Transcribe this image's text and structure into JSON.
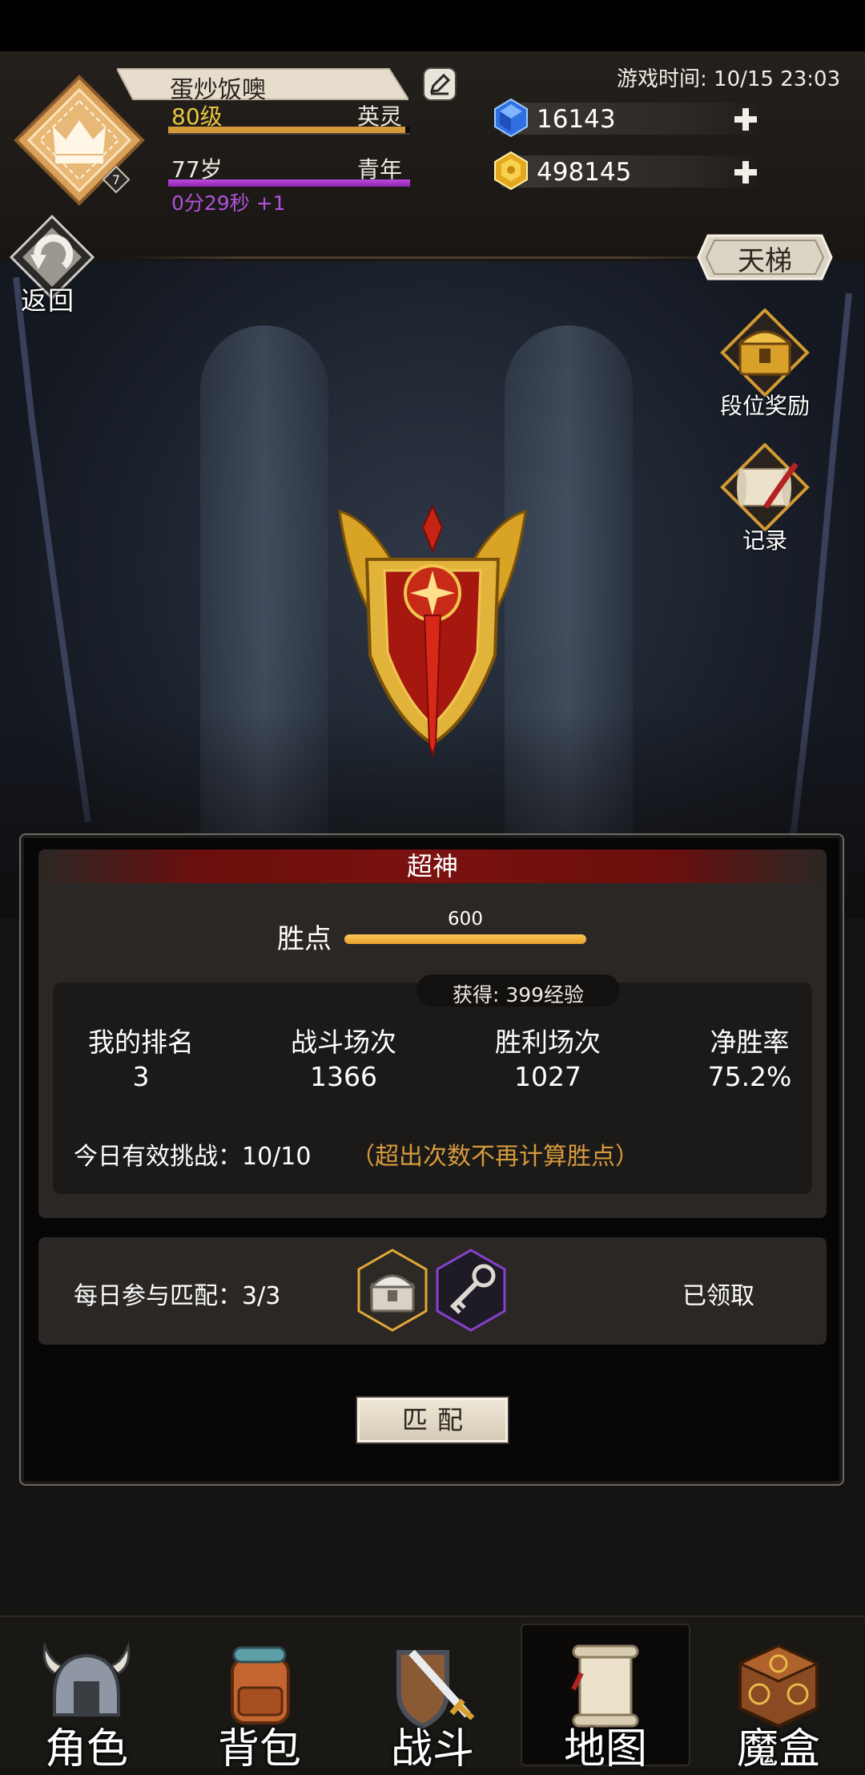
{
  "header": {
    "player_name": "蛋炒饭噢",
    "level": "80级",
    "class_name": "英灵",
    "level_progress": 0.98,
    "age": "77岁",
    "life_stage": "青年",
    "age_progress": 1.0,
    "age_timer": "0分29秒 +1",
    "avatar_level": "7",
    "game_time": "游戏时间: 10/15 23:03",
    "gems": "16143",
    "gold": "498145",
    "back_label": "返回"
  },
  "side_menu": {
    "ladder_label": "天梯",
    "rank_reward_label": "段位奖励",
    "record_label": "记录"
  },
  "rank_panel": {
    "rank_title": "超神",
    "points_label": "胜点",
    "points_value": "600",
    "points_progress": 1.0,
    "exp_gain": "获得: 399经验",
    "stats": [
      {
        "label": "我的排名",
        "value": "3"
      },
      {
        "label": "战斗场次",
        "value": "1366"
      },
      {
        "label": "胜利场次",
        "value": "1027"
      },
      {
        "label": "净胜率",
        "value": "75.2%"
      }
    ],
    "daily_challenge": "今日有效挑战：10/10",
    "daily_challenge_note": "（超出次数不再计算胜点）"
  },
  "match_panel": {
    "daily_match": "每日参与匹配：3/3",
    "claimed_label": "已领取",
    "match_button": "匹配"
  },
  "nav": {
    "items": [
      {
        "label": "角色",
        "icon": "helmet-icon"
      },
      {
        "label": "背包",
        "icon": "backpack-icon"
      },
      {
        "label": "战斗",
        "icon": "sword-shield-icon"
      },
      {
        "label": "地图",
        "icon": "scroll-map-icon"
      },
      {
        "label": "魔盒",
        "icon": "magic-box-icon"
      }
    ],
    "active": "地图"
  },
  "colors": {
    "level_text": "#e8c640",
    "age_bar": "#b152d8",
    "points_bar": "#e8a22a",
    "challenge_note": "#d69a3c",
    "rank_band": "#7a1210"
  }
}
